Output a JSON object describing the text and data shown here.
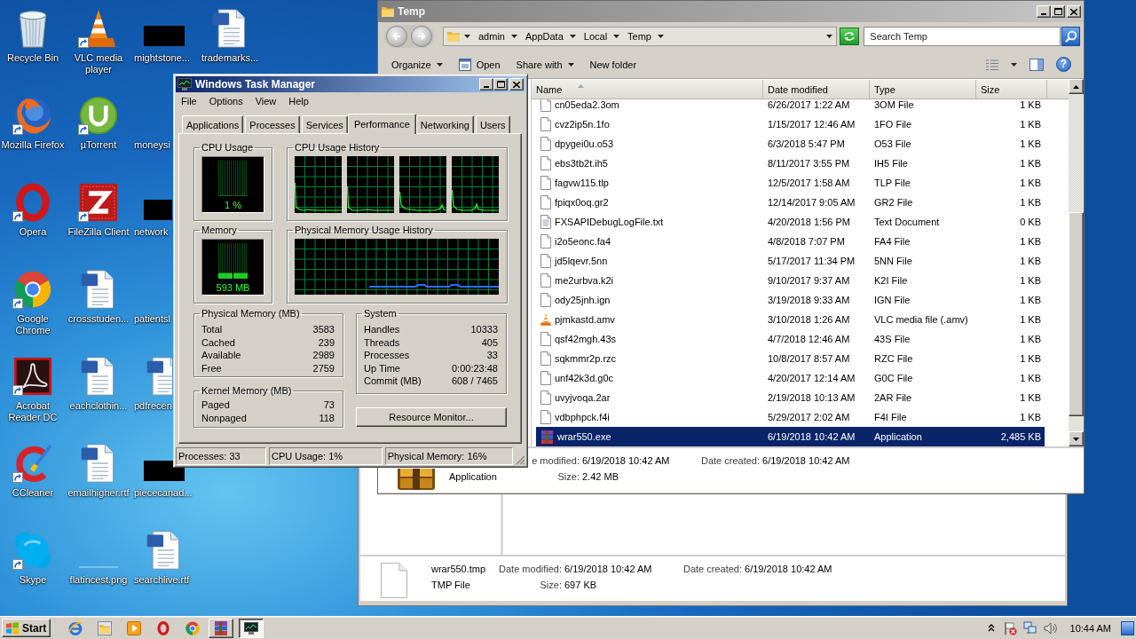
{
  "desktop": {
    "columns": [
      {
        "icons": [
          {
            "label": "Recycle Bin",
            "kind": "recycle",
            "shortcut": false,
            "clipped": false
          },
          {
            "label": "Mozilla Firefox",
            "kind": "firefox",
            "shortcut": true,
            "clipped": false
          },
          {
            "label": "Opera",
            "kind": "opera",
            "shortcut": true,
            "clipped": false
          },
          {
            "label": "Google Chrome",
            "kind": "chrome",
            "shortcut": true,
            "clipped": false
          },
          {
            "label": "Acrobat Reader DC",
            "kind": "acrobat",
            "shortcut": true,
            "clipped": false
          },
          {
            "label": "CCleaner",
            "kind": "ccleaner",
            "shortcut": true,
            "clipped": false
          },
          {
            "label": "Skype",
            "kind": "skype",
            "shortcut": true,
            "clipped": false
          }
        ]
      },
      {
        "icons": [
          {
            "label": "VLC media player",
            "kind": "vlc",
            "shortcut": true,
            "clipped": false
          },
          {
            "label": "µTorrent",
            "kind": "utorrent",
            "shortcut": true,
            "clipped": false
          },
          {
            "label": "FileZilla Client",
            "kind": "filezilla",
            "shortcut": true,
            "clipped": false
          },
          {
            "label": "crossstuden...",
            "kind": "document",
            "shortcut": false,
            "clipped": false
          },
          {
            "label": "eachclothin...",
            "kind": "document",
            "shortcut": false,
            "clipped": false
          },
          {
            "label": "emailhigher.rtf",
            "kind": "document",
            "shortcut": false,
            "clipped": false
          },
          {
            "label": "flatincest.png",
            "kind": "blank",
            "shortcut": false,
            "clipped": false
          }
        ]
      },
      {
        "icons": [
          {
            "label": "mightstone...",
            "kind": "thumbnail",
            "shortcut": false,
            "clipped": false
          },
          {
            "label": "moneysi",
            "kind": "covered",
            "shortcut": false,
            "clipped": false
          },
          {
            "label": "network",
            "kind": "thumbnail",
            "shortcut": false,
            "clipped": true
          },
          {
            "label": "patientsl",
            "kind": "covered",
            "shortcut": false,
            "clipped": false
          },
          {
            "label": "pdfrecen",
            "kind": "document",
            "shortcut": false,
            "clipped": true
          },
          {
            "label": "piececanad...",
            "kind": "thumbnail",
            "shortcut": false,
            "clipped": false
          },
          {
            "label": "searchlive.rtf",
            "kind": "document",
            "shortcut": false,
            "clipped": false
          }
        ]
      },
      {
        "icons": [
          {
            "label": "trademarks...",
            "kind": "document",
            "shortcut": false,
            "clipped": false
          }
        ]
      }
    ]
  },
  "explorer": {
    "title": "Temp",
    "breadcrumb": [
      "admin",
      "AppData",
      "Local",
      "Temp"
    ],
    "search": {
      "placeholder": "Search Temp"
    },
    "toolbar": [
      {
        "label": "Organize",
        "kind": "menu"
      },
      {
        "label": "Open",
        "kind": "open"
      },
      {
        "label": "Share with",
        "kind": "menu"
      },
      {
        "label": "New folder",
        "kind": "plain"
      }
    ],
    "help": "?",
    "columns": [
      {
        "label": "Name",
        "sorted": true
      },
      {
        "label": "Date modified",
        "sorted": false
      },
      {
        "label": "Type",
        "sorted": false
      },
      {
        "label": "Size",
        "sorted": false
      }
    ],
    "files": [
      {
        "name": "cn05eda2.3om",
        "date": "6/26/2017 1:22 AM",
        "type": "3OM File",
        "size": "1 KB",
        "kind": "blank",
        "selected": false
      },
      {
        "name": "cvz2ip5n.1fo",
        "date": "1/15/2017 12:46 AM",
        "type": "1FO File",
        "size": "1 KB",
        "kind": "blank",
        "selected": false
      },
      {
        "name": "dpygei0u.o53",
        "date": "6/3/2018 5:47 PM",
        "type": "O53 File",
        "size": "1 KB",
        "kind": "blank",
        "selected": false
      },
      {
        "name": "ebs3tb2t.ih5",
        "date": "8/11/2017 3:55 PM",
        "type": "IH5 File",
        "size": "1 KB",
        "kind": "blank",
        "selected": false
      },
      {
        "name": "fagvw115.tlp",
        "date": "12/5/2017 1:58 AM",
        "type": "TLP File",
        "size": "1 KB",
        "kind": "blank",
        "selected": false
      },
      {
        "name": "fpiqx0oq.gr2",
        "date": "12/14/2017 9:05 AM",
        "type": "GR2 File",
        "size": "1 KB",
        "kind": "blank",
        "selected": false
      },
      {
        "name": "FXSAPIDebugLogFile.txt",
        "date": "4/20/2018 1:56 PM",
        "type": "Text Document",
        "size": "0 KB",
        "kind": "text",
        "selected": false
      },
      {
        "name": "i2o5eonc.fa4",
        "date": "4/8/2018 7:07 PM",
        "type": "FA4 File",
        "size": "1 KB",
        "kind": "blank",
        "selected": false
      },
      {
        "name": "jd5lqevr.5nn",
        "date": "5/17/2017 11:34 PM",
        "type": "5NN File",
        "size": "1 KB",
        "kind": "blank",
        "selected": false
      },
      {
        "name": "me2urbva.k2i",
        "date": "9/10/2017 9:37 AM",
        "type": "K2I File",
        "size": "1 KB",
        "kind": "blank",
        "selected": false
      },
      {
        "name": "ody25jnh.ign",
        "date": "3/19/2018 9:33 AM",
        "type": "IGN File",
        "size": "1 KB",
        "kind": "blank",
        "selected": false
      },
      {
        "name": "pjmkastd.amv",
        "date": "3/10/2018 1:26 AM",
        "type": "VLC media file (.amv)",
        "size": "1 KB",
        "kind": "vlc",
        "selected": false
      },
      {
        "name": "qsf42mgh.43s",
        "date": "4/7/2018 12:46 AM",
        "type": "43S File",
        "size": "1 KB",
        "kind": "blank",
        "selected": false
      },
      {
        "name": "sqkmmr2p.rzc",
        "date": "10/8/2017 8:57 AM",
        "type": "RZC File",
        "size": "1 KB",
        "kind": "blank",
        "selected": false
      },
      {
        "name": "unf42k3d.g0c",
        "date": "4/20/2017 12:14 AM",
        "type": "G0C File",
        "size": "1 KB",
        "kind": "blank",
        "selected": false
      },
      {
        "name": "uvyjvoqa.2ar",
        "date": "2/19/2018 10:13 AM",
        "type": "2AR File",
        "size": "1 KB",
        "kind": "blank",
        "selected": false
      },
      {
        "name": "vdbphpck.f4i",
        "date": "5/29/2017 2:02 AM",
        "type": "F4I File",
        "size": "1 KB",
        "kind": "blank",
        "selected": false
      },
      {
        "name": "wrar550.exe",
        "date": "6/19/2018 10:42 AM",
        "type": "Application",
        "size": "2,485 KB",
        "kind": "archive",
        "selected": true
      }
    ],
    "details": {
      "kind": "archive",
      "type": "Application",
      "modified": {
        "label": "e modified:",
        "value": "6/19/2018 10:42 AM"
      },
      "created": {
        "label": "Date created:",
        "value": "6/19/2018 10:42 AM"
      },
      "size": {
        "label": "Size:",
        "value": "2.42 MB"
      }
    }
  },
  "task_manager": {
    "title": "Windows Task Manager",
    "menu": [
      "File",
      "Options",
      "View",
      "Help"
    ],
    "tabs": [
      {
        "label": "Applications",
        "selected": false
      },
      {
        "label": "Processes",
        "selected": false
      },
      {
        "label": "Services",
        "selected": false
      },
      {
        "label": "Performance",
        "selected": true
      },
      {
        "label": "Networking",
        "selected": false
      },
      {
        "label": "Users",
        "selected": false
      }
    ],
    "cpu_usage": {
      "title": "CPU Usage",
      "reading": "1 %",
      "level": 0.01
    },
    "cpu_history": {
      "title": "CPU Usage History"
    },
    "memory": {
      "title": "Memory",
      "reading": "593 MB",
      "level": 0.16
    },
    "memory_history": {
      "title": "Physical Memory Usage History"
    },
    "physical_memory": {
      "title": "Physical Memory (MB)",
      "rows": [
        {
          "label": "Total",
          "value": "3583"
        },
        {
          "label": "Cached",
          "value": "239"
        },
        {
          "label": "Available",
          "value": "2989"
        },
        {
          "label": "Free",
          "value": "2759"
        }
      ]
    },
    "system": {
      "title": "System",
      "rows": [
        {
          "label": "Handles",
          "value": "10333"
        },
        {
          "label": "Threads",
          "value": "405"
        },
        {
          "label": "Processes",
          "value": "33"
        },
        {
          "label": "Up Time",
          "value": "0:00:23:48"
        },
        {
          "label": "Commit (MB)",
          "value": "608 / 7465"
        }
      ]
    },
    "kernel_memory": {
      "title": "Kernel Memory (MB)",
      "rows": [
        {
          "label": "Paged",
          "value": "73"
        },
        {
          "label": "Nonpaged",
          "value": "118"
        }
      ]
    },
    "resource_button": "Resource Monitor...",
    "status_bar": [
      "Processes: 33",
      "CPU Usage: 1%",
      "Physical Memory: 16%"
    ]
  },
  "background_window": {
    "details": {
      "kind": "blank",
      "name": "wrar550.tmp",
      "type": "TMP File",
      "modified": {
        "label": "Date modified:",
        "value": "6/19/2018 10:42 AM"
      },
      "created": {
        "label": "Date created:",
        "value": "6/19/2018 10:42 AM"
      },
      "size": {
        "label": "Size:",
        "value": "697 KB"
      }
    }
  },
  "taskbar": {
    "start": "Start",
    "buttons": [
      {
        "kind": "archive",
        "selected": false
      },
      {
        "kind": "monitor",
        "selected": true
      }
    ],
    "clock": "10:44 AM"
  }
}
